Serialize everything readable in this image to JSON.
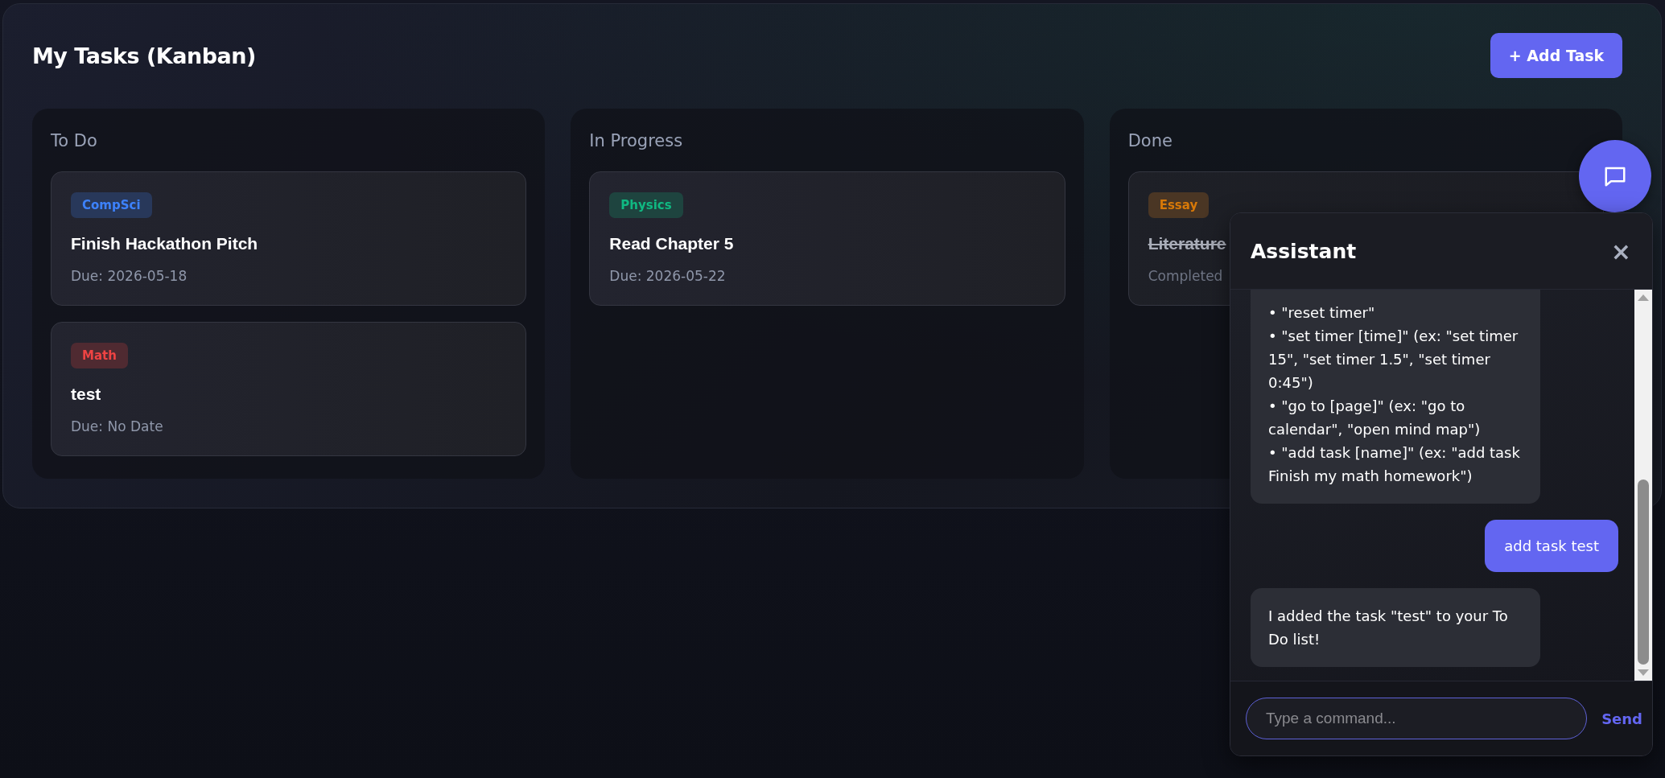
{
  "board": {
    "title": "My Tasks (Kanban)",
    "add_button": "+ Add Task",
    "columns": [
      {
        "title": "To Do",
        "cards": [
          {
            "tag": "CompSci",
            "color": "#28385a",
            "title": "Finish Hackathon Pitch",
            "due": "Due: 2026-05-18",
            "completed": false
          },
          {
            "tag": "Math",
            "color": "#4f2a31",
            "title": "test",
            "due": "Due: No Date",
            "completed": false
          }
        ]
      },
      {
        "title": "In Progress",
        "cards": [
          {
            "tag": "Physics",
            "color": "#1e443f",
            "title": "Read Chapter 5",
            "due": "Due: 2026-05-22",
            "completed": false
          }
        ]
      },
      {
        "title": "Done",
        "cards": [
          {
            "tag": "Essay",
            "color": "#4a3624",
            "title": "Literature",
            "due": "Completed",
            "completed": true
          }
        ]
      }
    ]
  },
  "chat": {
    "title": "Assistant",
    "close": "×",
    "messages": [
      {
        "kind": "bot",
        "continued": true,
        "lines": [
          "• \"reset timer\"",
          "• \"set timer [time]\" (ex: \"set timer 15\", \"set timer 1.5\", \"set timer 0:45\")",
          "• \"go to [page]\" (ex: \"go to calendar\", \"open mind map\")",
          "• \"add task [name]\" (ex: \"add task Finish my math homework\")"
        ]
      },
      {
        "kind": "user",
        "continued": false,
        "lines": [
          "add task test"
        ]
      },
      {
        "kind": "bot",
        "continued": false,
        "lines": [
          "I added the task \"test\" to your To Do list!"
        ]
      }
    ],
    "input": {
      "placeholder": "Type a command..."
    },
    "send": "Send"
  }
}
